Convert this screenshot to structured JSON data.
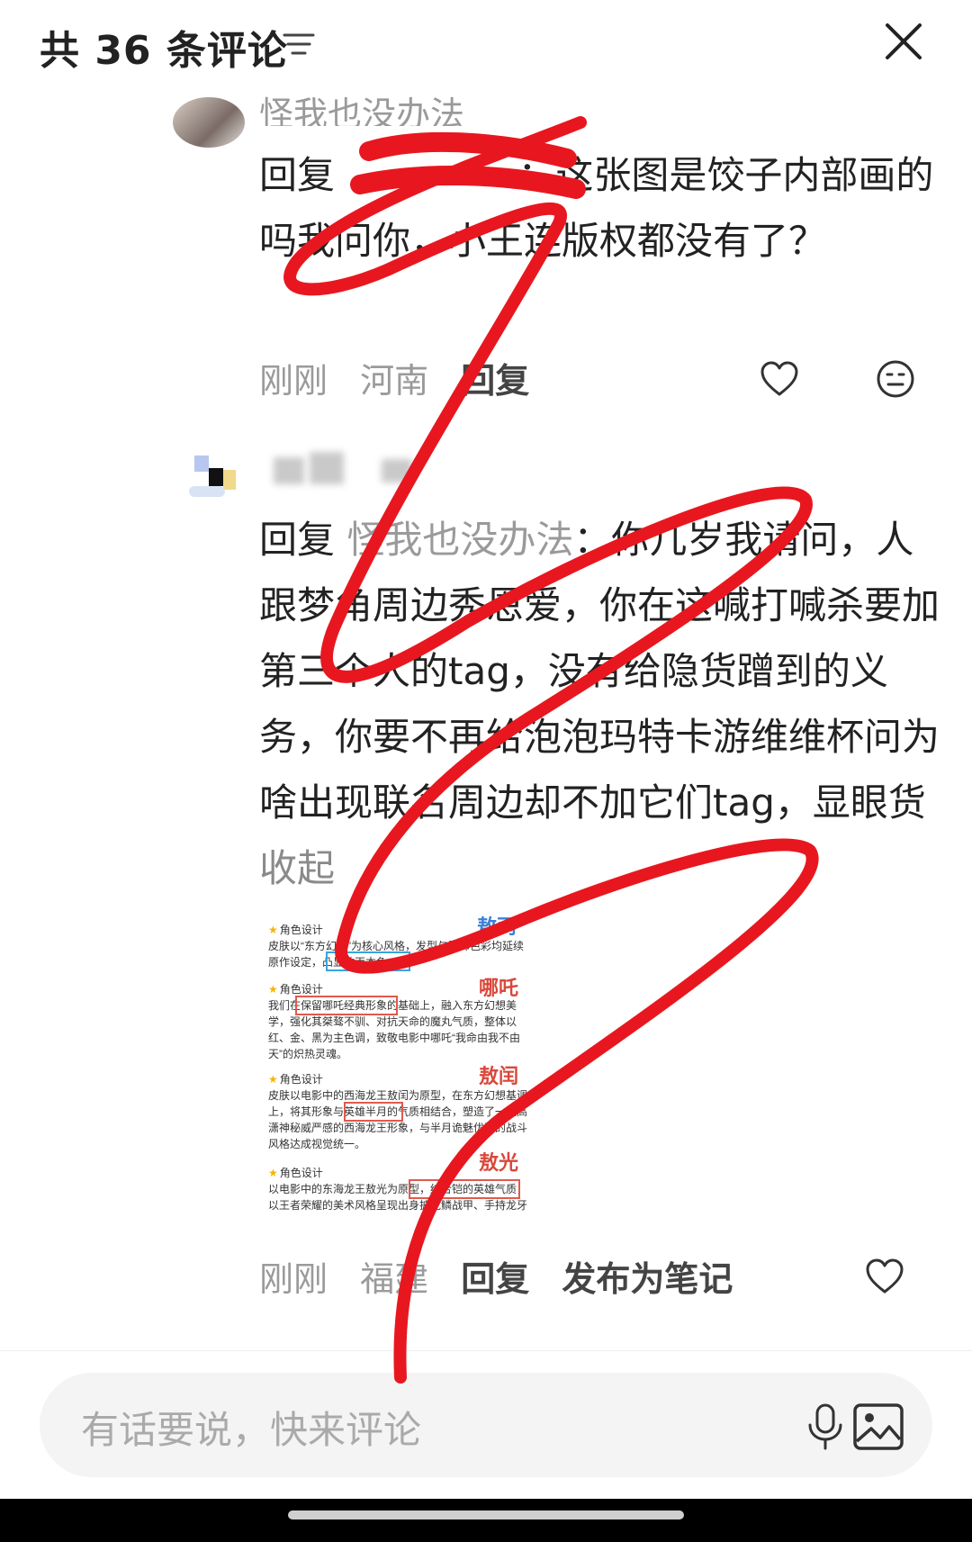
{
  "header": {
    "title": "共 36 条评论"
  },
  "comments": [
    {
      "username": "怪我也没办法",
      "reply_prefix": "回复",
      "mention": "",
      "text": "：这张图是饺子内部画的吗我问你，小王连版权都没有了？",
      "time": "刚刚",
      "location": "河南",
      "reply_label": "回复"
    },
    {
      "username": "",
      "reply_prefix": "回复",
      "mention": "怪我也没办法",
      "text": "：你几岁我请问，人跟梦角周边秀恩爱，你在这喊打喊杀要加第三个人的tag，没有给隐货蹭到的义务，你要不再给泡泡玛特卡游维维杯问为啥出现联名周边却不加它们tag，显眼货",
      "collapse_label": "收起",
      "time": "刚刚",
      "location": "福建",
      "reply_label": "回复",
      "publish_note_label": "发布为笔记"
    }
  ],
  "attached_image": {
    "sections": [
      {
        "name": "敖丙",
        "lines": [
          "角色设计",
          "皮肤以“东方幻想”为核心风格，发型与服饰色彩均延续",
          "原作设定，凸显敖丙本色。"
        ]
      },
      {
        "name": "哪吒",
        "lines": [
          "角色设计",
          "我们在保留哪吒经典形象的基础上，融入东方幻想美",
          "学，强化其桀骜不驯、对抗天命的魔丸气质，整体以",
          "红、金、黑为主色调，致敬电影中哪吒“我命由我不由",
          "天”的炽热灵魂。"
        ]
      },
      {
        "name": "敖闰",
        "lines": [
          "角色设计",
          "皮肤以电影中的西海龙王敖闰为原型，在东方幻想基调",
          "上，将其形象与英雄半月的气质相结合，塑造了一位高",
          "潇神秘威严感的西海龙王形象，与半月诡魅优雅的战斗",
          "风格达成视觉统一。"
        ]
      },
      {
        "name": "敖光",
        "lines": [
          "角色设计",
          "以电影中的东海龙王敖光为原型，结合铠的英雄气质，",
          "以王者荣耀的美术风格呈现出身披龙鳞战甲、手持龙牙"
        ]
      }
    ]
  },
  "input": {
    "placeholder": "有话要说，快来评论"
  },
  "icons": {
    "sort": "sort-filter-icon",
    "close": "close-icon",
    "like": "heart-outline-icon",
    "emoji": "emoji-face-icon",
    "mic": "microphone-icon",
    "image": "image-picker-icon"
  },
  "colors": {
    "scribble": "#e8171f",
    "secondary_text": "#9a9a9a",
    "input_bg": "#f4f4f4"
  }
}
